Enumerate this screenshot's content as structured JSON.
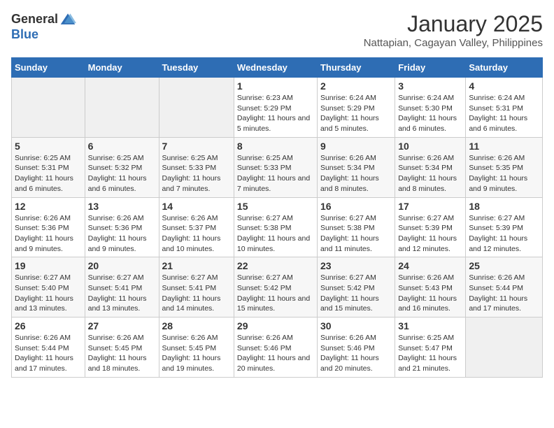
{
  "logo": {
    "general": "General",
    "blue": "Blue"
  },
  "title": "January 2025",
  "subtitle": "Nattapian, Cagayan Valley, Philippines",
  "days_of_week": [
    "Sunday",
    "Monday",
    "Tuesday",
    "Wednesday",
    "Thursday",
    "Friday",
    "Saturday"
  ],
  "weeks": [
    [
      {
        "day": "",
        "sunrise": "",
        "sunset": "",
        "daylight": ""
      },
      {
        "day": "",
        "sunrise": "",
        "sunset": "",
        "daylight": ""
      },
      {
        "day": "",
        "sunrise": "",
        "sunset": "",
        "daylight": ""
      },
      {
        "day": "1",
        "sunrise": "6:23 AM",
        "sunset": "5:29 PM",
        "daylight": "11 hours and 5 minutes."
      },
      {
        "day": "2",
        "sunrise": "6:24 AM",
        "sunset": "5:29 PM",
        "daylight": "11 hours and 5 minutes."
      },
      {
        "day": "3",
        "sunrise": "6:24 AM",
        "sunset": "5:30 PM",
        "daylight": "11 hours and 6 minutes."
      },
      {
        "day": "4",
        "sunrise": "6:24 AM",
        "sunset": "5:31 PM",
        "daylight": "11 hours and 6 minutes."
      }
    ],
    [
      {
        "day": "5",
        "sunrise": "6:25 AM",
        "sunset": "5:31 PM",
        "daylight": "11 hours and 6 minutes."
      },
      {
        "day": "6",
        "sunrise": "6:25 AM",
        "sunset": "5:32 PM",
        "daylight": "11 hours and 6 minutes."
      },
      {
        "day": "7",
        "sunrise": "6:25 AM",
        "sunset": "5:33 PM",
        "daylight": "11 hours and 7 minutes."
      },
      {
        "day": "8",
        "sunrise": "6:25 AM",
        "sunset": "5:33 PM",
        "daylight": "11 hours and 7 minutes."
      },
      {
        "day": "9",
        "sunrise": "6:26 AM",
        "sunset": "5:34 PM",
        "daylight": "11 hours and 8 minutes."
      },
      {
        "day": "10",
        "sunrise": "6:26 AM",
        "sunset": "5:34 PM",
        "daylight": "11 hours and 8 minutes."
      },
      {
        "day": "11",
        "sunrise": "6:26 AM",
        "sunset": "5:35 PM",
        "daylight": "11 hours and 9 minutes."
      }
    ],
    [
      {
        "day": "12",
        "sunrise": "6:26 AM",
        "sunset": "5:36 PM",
        "daylight": "11 hours and 9 minutes."
      },
      {
        "day": "13",
        "sunrise": "6:26 AM",
        "sunset": "5:36 PM",
        "daylight": "11 hours and 9 minutes."
      },
      {
        "day": "14",
        "sunrise": "6:26 AM",
        "sunset": "5:37 PM",
        "daylight": "11 hours and 10 minutes."
      },
      {
        "day": "15",
        "sunrise": "6:27 AM",
        "sunset": "5:38 PM",
        "daylight": "11 hours and 10 minutes."
      },
      {
        "day": "16",
        "sunrise": "6:27 AM",
        "sunset": "5:38 PM",
        "daylight": "11 hours and 11 minutes."
      },
      {
        "day": "17",
        "sunrise": "6:27 AM",
        "sunset": "5:39 PM",
        "daylight": "11 hours and 12 minutes."
      },
      {
        "day": "18",
        "sunrise": "6:27 AM",
        "sunset": "5:39 PM",
        "daylight": "11 hours and 12 minutes."
      }
    ],
    [
      {
        "day": "19",
        "sunrise": "6:27 AM",
        "sunset": "5:40 PM",
        "daylight": "11 hours and 13 minutes."
      },
      {
        "day": "20",
        "sunrise": "6:27 AM",
        "sunset": "5:41 PM",
        "daylight": "11 hours and 13 minutes."
      },
      {
        "day": "21",
        "sunrise": "6:27 AM",
        "sunset": "5:41 PM",
        "daylight": "11 hours and 14 minutes."
      },
      {
        "day": "22",
        "sunrise": "6:27 AM",
        "sunset": "5:42 PM",
        "daylight": "11 hours and 15 minutes."
      },
      {
        "day": "23",
        "sunrise": "6:27 AM",
        "sunset": "5:42 PM",
        "daylight": "11 hours and 15 minutes."
      },
      {
        "day": "24",
        "sunrise": "6:26 AM",
        "sunset": "5:43 PM",
        "daylight": "11 hours and 16 minutes."
      },
      {
        "day": "25",
        "sunrise": "6:26 AM",
        "sunset": "5:44 PM",
        "daylight": "11 hours and 17 minutes."
      }
    ],
    [
      {
        "day": "26",
        "sunrise": "6:26 AM",
        "sunset": "5:44 PM",
        "daylight": "11 hours and 17 minutes."
      },
      {
        "day": "27",
        "sunrise": "6:26 AM",
        "sunset": "5:45 PM",
        "daylight": "11 hours and 18 minutes."
      },
      {
        "day": "28",
        "sunrise": "6:26 AM",
        "sunset": "5:45 PM",
        "daylight": "11 hours and 19 minutes."
      },
      {
        "day": "29",
        "sunrise": "6:26 AM",
        "sunset": "5:46 PM",
        "daylight": "11 hours and 20 minutes."
      },
      {
        "day": "30",
        "sunrise": "6:26 AM",
        "sunset": "5:46 PM",
        "daylight": "11 hours and 20 minutes."
      },
      {
        "day": "31",
        "sunrise": "6:25 AM",
        "sunset": "5:47 PM",
        "daylight": "11 hours and 21 minutes."
      },
      {
        "day": "",
        "sunrise": "",
        "sunset": "",
        "daylight": ""
      }
    ]
  ],
  "labels": {
    "sunrise": "Sunrise:",
    "sunset": "Sunset:",
    "daylight": "Daylight:"
  }
}
